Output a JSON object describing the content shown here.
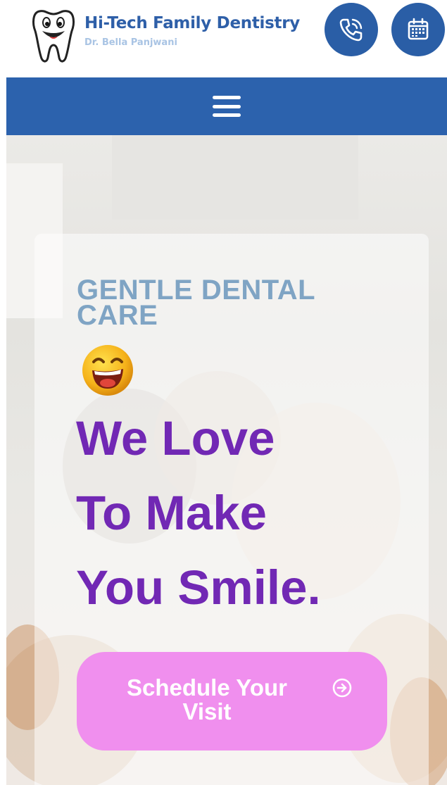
{
  "header": {
    "title": "Hi-Tech Family Dentistry",
    "subtitle": "Dr. Bella Panjwani",
    "logo_icon": "tooth-icon",
    "phone_icon": "phone-icon",
    "calendar_icon": "calendar-icon"
  },
  "nav": {
    "menu_icon": "hamburger-menu-icon"
  },
  "hero": {
    "eyebrow": "GENTLE DENTAL CARE",
    "emoji_icon": "laughing-emoji-icon",
    "headline_line1": "We Love",
    "headline_line2": "To Make",
    "headline_line3": "You Smile.",
    "cta_label": "Schedule Your Visit",
    "cta_icon": "arrow-right-circle-icon"
  },
  "colors": {
    "brand_blue": "#2c62ad",
    "headline_purple": "#7128b4",
    "eyebrow_blue": "#7fa4c4",
    "cta_pink": "#f08fee"
  }
}
